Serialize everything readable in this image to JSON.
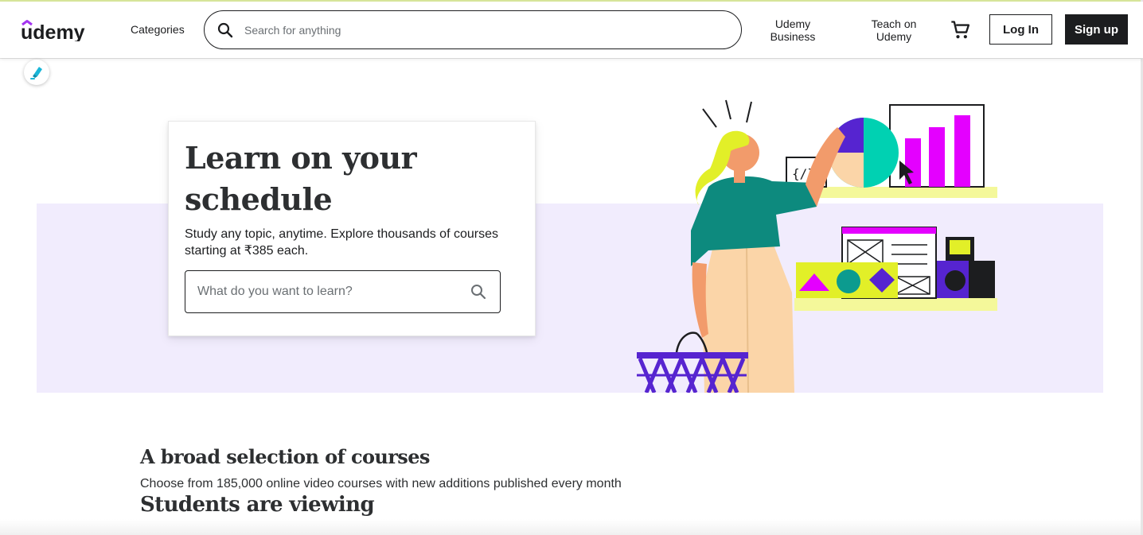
{
  "header": {
    "logo_text": "udemy",
    "categories_label": "Categories",
    "search_placeholder": "Search for anything",
    "business_label_line1": "Udemy",
    "business_label_line2": "Business",
    "teach_label_line1": "Teach on",
    "teach_label_line2": "Udemy",
    "cart_icon": "cart-icon",
    "login_label": "Log In",
    "signup_label": "Sign up"
  },
  "hero": {
    "title_line1": "Learn on your",
    "title_line2": "schedule",
    "subtitle": "Study any topic, anytime. Explore thousands of courses starting at ₹385 each.",
    "search_placeholder": "What do you want to learn?"
  },
  "sections": {
    "selection_title": "A broad selection of courses",
    "selection_subtitle": "Choose from 185,000 online video courses with new additions published every month",
    "viewing_title": "Students are viewing"
  },
  "colors": {
    "brand_purple": "#a435f0",
    "hero_band": "#f1ecfd",
    "text_dark": "#1c1d1f",
    "illustration_magenta": "#e400ff",
    "illustration_teal": "#00d1b2",
    "illustration_purple": "#5624d0",
    "illustration_yellow": "#f4f89a"
  }
}
